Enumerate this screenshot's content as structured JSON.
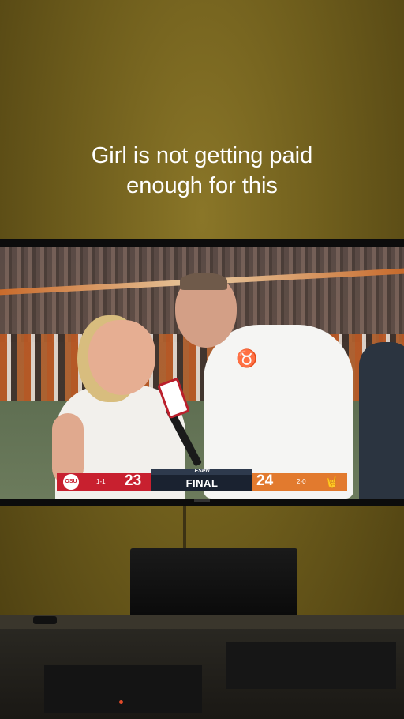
{
  "caption": {
    "line1": "Girl is not getting paid",
    "line2": "enough for this"
  },
  "scorebug": {
    "network": "ESPN",
    "status": "FINAL",
    "away": {
      "logo": "OSU",
      "record": "1-1",
      "score": "23",
      "color": "#c8202f"
    },
    "home": {
      "logo": "🤘",
      "record": "2-0",
      "score": "24",
      "color": "#e27a2e"
    }
  },
  "icons": {
    "mic_flag": "espn-mic-flag",
    "texas_logo": "longhorn-icon"
  }
}
